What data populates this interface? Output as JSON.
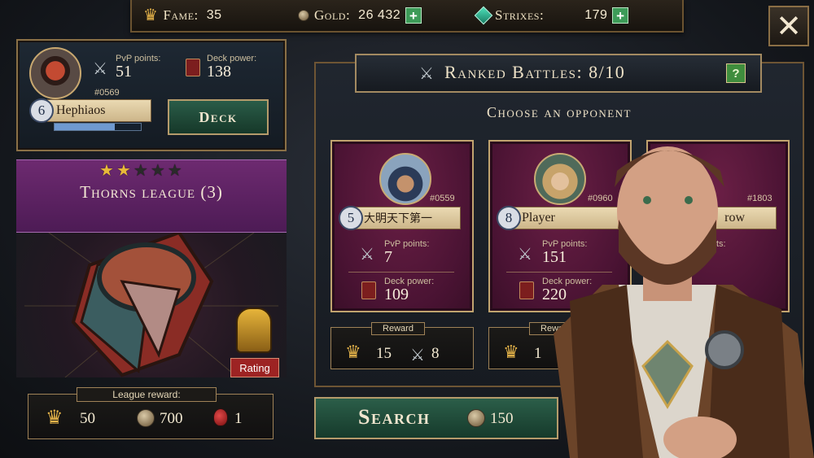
{
  "topbar": {
    "fame": {
      "label": "Fame:",
      "value": "35"
    },
    "gold": {
      "label": "Gold:",
      "value": "26 432"
    },
    "strixes": {
      "label": "Strixes:",
      "value": "179"
    }
  },
  "player": {
    "pvp_label": "PvP points:",
    "pvp_value": "51",
    "deck_label": "Deck power:",
    "deck_value": "138",
    "id": "#0569",
    "level": "6",
    "name": "Hephiaos",
    "xp_fraction": 0.7,
    "deck_button": "Deck"
  },
  "league": {
    "stars_filled": 2,
    "stars_total": 5,
    "title": "Thorns league (3)",
    "rating_button": "Rating",
    "reward_label": "League reward:",
    "reward_fame": "50",
    "reward_gold": "700",
    "reward_potion": "1"
  },
  "battles": {
    "title": "Ranked Battles: 8/10",
    "help": "?",
    "choose": "Choose an opponent",
    "pvp_label": "PvP points:",
    "deck_label": "Deck power:",
    "reward_label": "Reward",
    "opponents": [
      {
        "id": "#0559",
        "level": "5",
        "name": "大明天下第一",
        "pvp": "7",
        "deck": "109",
        "reward_fame": "15",
        "reward_pvp": "8"
      },
      {
        "id": "#0960",
        "level": "8",
        "name": "Player",
        "pvp": "151",
        "deck": "220",
        "reward_fame": "1",
        "reward_pvp": ""
      },
      {
        "id": "#1803",
        "level": "",
        "name": "row",
        "pvp": "",
        "deck": "",
        "reward_fame": "",
        "reward_pvp": ""
      }
    ],
    "search_button": "Search",
    "search_cost": "150"
  },
  "colors": {
    "accent_gold": "#c1a46f",
    "league_purple": "#6d2a70",
    "card_magenta": "#4a1333",
    "button_green": "#2b5e49"
  }
}
